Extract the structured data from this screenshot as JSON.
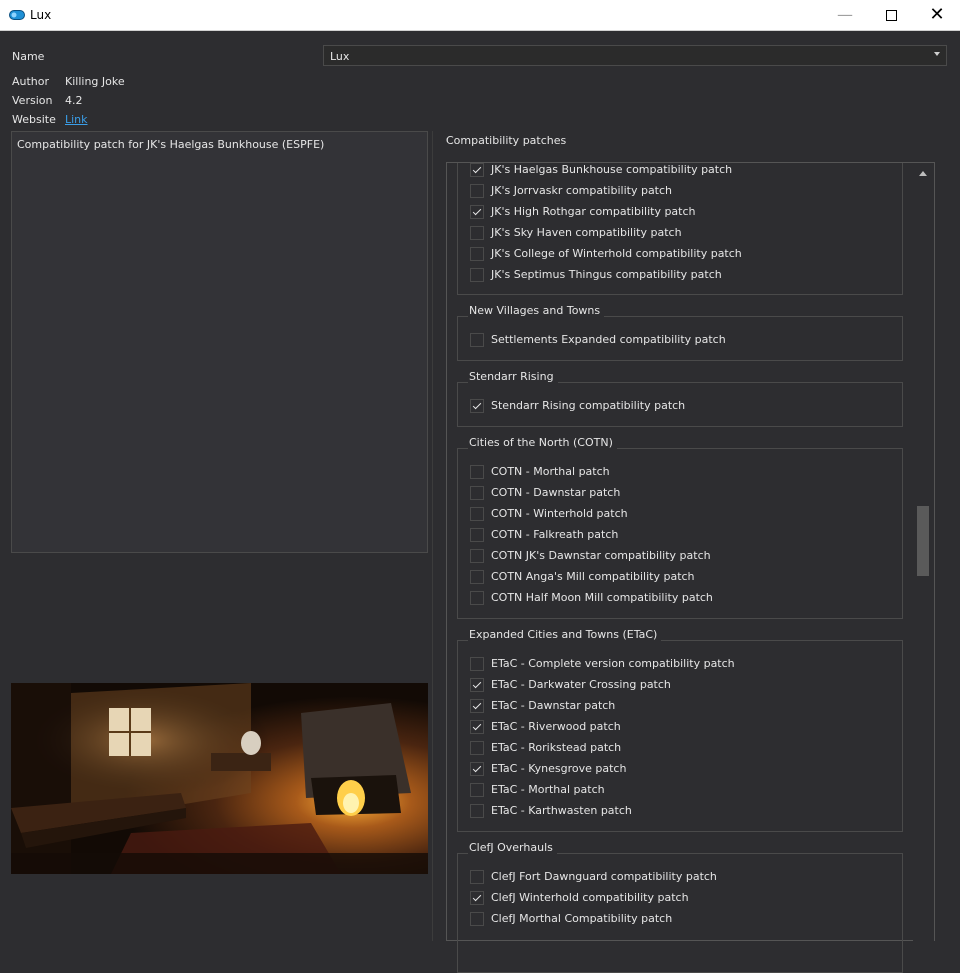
{
  "window": {
    "title": "Lux",
    "app_icon": "lux-app-icon",
    "minimize_glyph": "—",
    "close_glyph": "✕"
  },
  "fields": {
    "name_label": "Name",
    "name_value": "Lux",
    "author_label": "Author",
    "author_value": "Killing Joke",
    "version_label": "Version",
    "version_value": "4.2",
    "website_label": "Website",
    "website_value": "Link"
  },
  "description": "Compatibility patch for JK's Haelgas Bunkhouse (ESPFE)",
  "patches_label": "Compatibility patches",
  "groups": [
    {
      "title": "",
      "items": [
        {
          "label": "JK's Haelgas Bunkhouse compatibility patch",
          "checked": true
        },
        {
          "label": "JK's Jorrvaskr compatibility patch",
          "checked": false
        },
        {
          "label": "JK's High Rothgar compatibility patch",
          "checked": true
        },
        {
          "label": "JK's Sky Haven compatibility patch",
          "checked": false
        },
        {
          "label": "JK's College of Winterhold compatibility patch",
          "checked": false
        },
        {
          "label": "JK's Septimus Thingus compatibility patch",
          "checked": false
        }
      ]
    },
    {
      "title": "New Villages and Towns",
      "items": [
        {
          "label": "Settlements Expanded compatibility patch",
          "checked": false
        }
      ]
    },
    {
      "title": "Stendarr Rising",
      "items": [
        {
          "label": "Stendarr Rising compatibility patch",
          "checked": true
        }
      ]
    },
    {
      "title": "Cities of the North (COTN)",
      "items": [
        {
          "label": "COTN - Morthal patch",
          "checked": false
        },
        {
          "label": "COTN - Dawnstar patch",
          "checked": false
        },
        {
          "label": "COTN - Winterhold patch",
          "checked": false
        },
        {
          "label": "COTN - Falkreath patch",
          "checked": false
        },
        {
          "label": "COTN JK's Dawnstar compatibility patch",
          "checked": false
        },
        {
          "label": "COTN Anga's Mill compatibility patch",
          "checked": false
        },
        {
          "label": "COTN Half Moon Mill compatibility patch",
          "checked": false
        }
      ]
    },
    {
      "title": "Expanded Cities and Towns (ETaC)",
      "items": [
        {
          "label": "ETaC - Complete version compatibility patch",
          "checked": false
        },
        {
          "label": "ETaC - Darkwater Crossing patch",
          "checked": true
        },
        {
          "label": "ETaC - Dawnstar patch",
          "checked": true
        },
        {
          "label": "ETaC - Riverwood patch",
          "checked": true
        },
        {
          "label": "ETaC - Rorikstead patch",
          "checked": false
        },
        {
          "label": "ETaC - Kynesgrove patch",
          "checked": true
        },
        {
          "label": "ETaC - Morthal patch",
          "checked": false
        },
        {
          "label": "ETaC - Karthwasten patch",
          "checked": false
        }
      ]
    },
    {
      "title": "ClefJ Overhauls",
      "items": [
        {
          "label": "ClefJ Fort Dawnguard compatibility patch",
          "checked": false
        },
        {
          "label": "ClefJ Winterhold compatibility patch",
          "checked": true
        },
        {
          "label": "ClefJ Morthal Compatibility patch",
          "checked": false
        }
      ]
    }
  ],
  "colors": {
    "background": "#2d2d30",
    "text": "#e6e6e6",
    "link": "#3a9ee8",
    "border": "#4a4a4a"
  }
}
